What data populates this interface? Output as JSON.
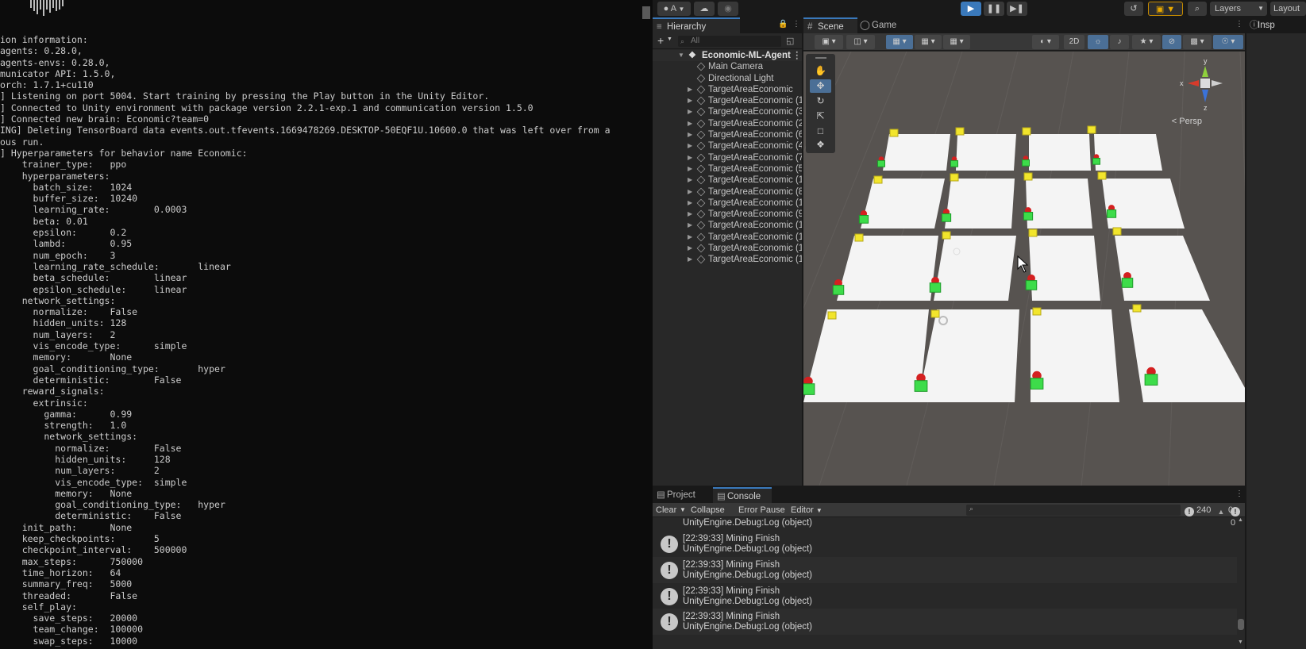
{
  "terminal": {
    "lines": [
      "ion information:",
      "agents: 0.28.0,",
      "agents-envs: 0.28.0,",
      "municator API: 1.5.0,",
      "orch: 1.7.1+cu110",
      "] Listening on port 5004. Start training by pressing the Play button in the Unity Editor.",
      "] Connected to Unity environment with package version 2.2.1-exp.1 and communication version 1.5.0",
      "] Connected new brain: Economic?team=0",
      "ING] Deleting TensorBoard data events.out.tfevents.1669478269.DESKTOP-50EQF1U.10600.0 that was left over from a",
      "ous run.",
      "] Hyperparameters for behavior name Economic:",
      "    trainer_type:   ppo",
      "    hyperparameters:",
      "      batch_size:   1024",
      "      buffer_size:  10240",
      "      learning_rate:        0.0003",
      "      beta: 0.01",
      "      epsilon:      0.2",
      "      lambd:        0.95",
      "      num_epoch:    3",
      "      learning_rate_schedule:       linear",
      "      beta_schedule:        linear",
      "      epsilon_schedule:     linear",
      "    network_settings:",
      "      normalize:    False",
      "      hidden_units: 128",
      "      num_layers:   2",
      "      vis_encode_type:      simple",
      "      memory:       None",
      "      goal_conditioning_type:       hyper",
      "      deterministic:        False",
      "    reward_signals:",
      "      extrinsic:",
      "        gamma:      0.99",
      "        strength:   1.0",
      "        network_settings:",
      "          normalize:        False",
      "          hidden_units:     128",
      "          num_layers:       2",
      "          vis_encode_type:  simple",
      "          memory:   None",
      "          goal_conditioning_type:   hyper",
      "          deterministic:    False",
      "    init_path:      None",
      "    keep_checkpoints:       5",
      "    checkpoint_interval:    500000",
      "    max_steps:      750000",
      "    time_horizon:   64",
      "    summary_freq:   5000",
      "    threaded:       False",
      "    self_play:",
      "      save_steps:   20000",
      "      team_change:  100000",
      "      swap_steps:   10000"
    ]
  },
  "toolbar": {
    "account_label": "A",
    "layers_label": "Layers",
    "layout_label": "Layout"
  },
  "hierarchy": {
    "tab_label": "Hierarchy",
    "search_placeholder": "All",
    "scene_name": "Economic-ML-Agent",
    "items": [
      "Main Camera",
      "Directional Light",
      "TargetAreaEconomic",
      "TargetAreaEconomic (1",
      "TargetAreaEconomic (3",
      "TargetAreaEconomic (2",
      "TargetAreaEconomic (6",
      "TargetAreaEconomic (4",
      "TargetAreaEconomic (7",
      "TargetAreaEconomic (5",
      "TargetAreaEconomic (1",
      "TargetAreaEconomic (8",
      "TargetAreaEconomic (1",
      "TargetAreaEconomic (9",
      "TargetAreaEconomic (1",
      "TargetAreaEconomic (1",
      "TargetAreaEconomic (1",
      "TargetAreaEconomic (1"
    ]
  },
  "scene": {
    "scene_tab": "Scene",
    "game_tab": "Game",
    "mode_2d": "2D",
    "persp_label": "< Persp",
    "gizmo_y": "y",
    "gizmo_x": "x",
    "gizmo_z": "z"
  },
  "inspector": {
    "tab_label": "Insp"
  },
  "console": {
    "project_tab": "Project",
    "console_tab": "Console",
    "clear_label": "Clear",
    "collapse_label": "Collapse",
    "error_pause_label": "Error Pause",
    "editor_label": "Editor",
    "log_count": "240",
    "warn_count": "0",
    "error_count": "0",
    "partial_line": "UnityEngine.Debug:Log (object)",
    "entries": [
      {
        "time_msg": "[22:39:33] Mining Finish",
        "trace": "UnityEngine.Debug:Log (object)"
      },
      {
        "time_msg": "[22:39:33] Mining Finish",
        "trace": "UnityEngine.Debug:Log (object)"
      },
      {
        "time_msg": "[22:39:33] Mining Finish",
        "trace": "UnityEngine.Debug:Log (object)"
      },
      {
        "time_msg": "[22:39:33] Mining Finish",
        "trace": "UnityEngine.Debug:Log (object)"
      }
    ]
  },
  "colors": {
    "accent": "#3a79bb",
    "panel": "#282828",
    "ground": "#575350",
    "tile": "#f4f4f4",
    "agent_green": "#3ddc4a",
    "agent_red": "#d42020",
    "target_yellow": "#f2e52c"
  }
}
